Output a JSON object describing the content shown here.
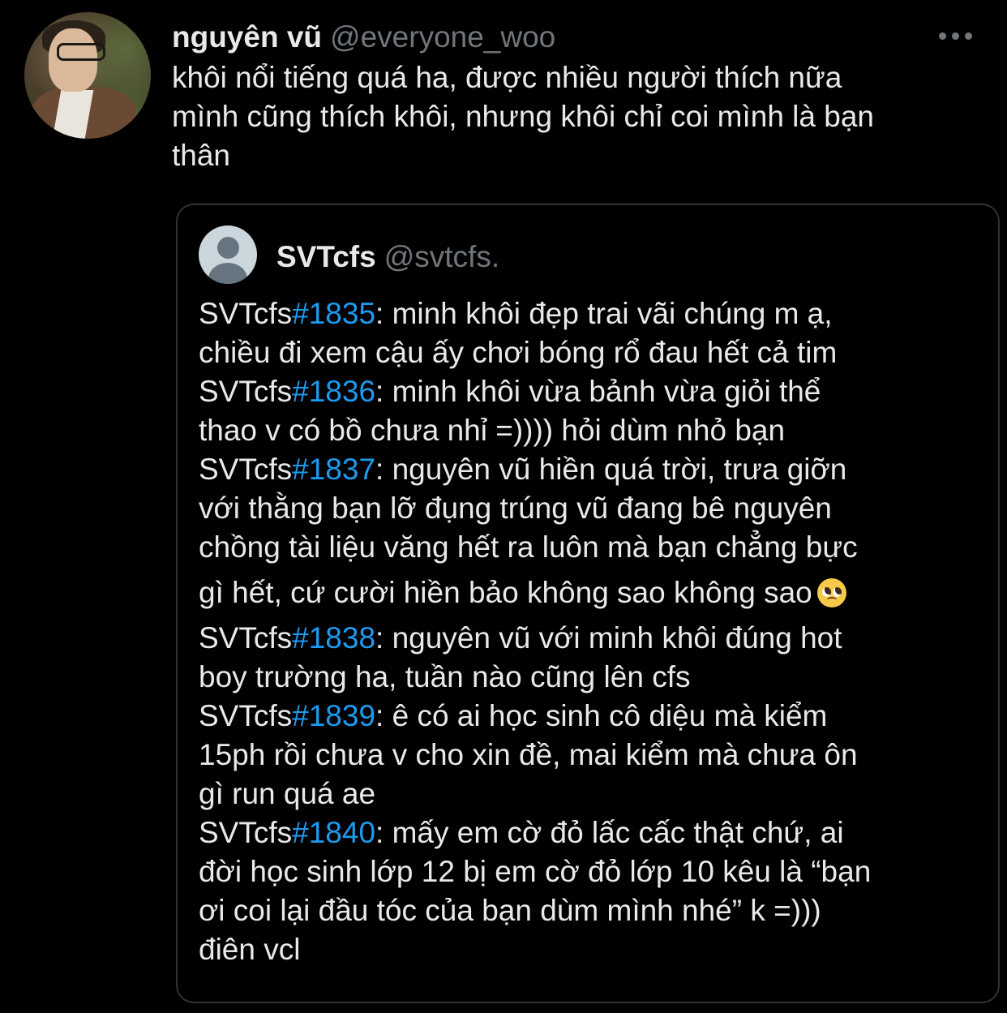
{
  "tweet": {
    "display_name": "nguyên vũ",
    "handle": "@everyone_woo",
    "more_icon": "more-horizontal-icon",
    "text_lines": [
      "khôi nổi tiếng quá ha, được nhiều người thích nữa",
      "mình cũng thích khôi, nhưng khôi chỉ coi mình là bạn",
      "thân"
    ]
  },
  "quote": {
    "display_name": "SVTcfs",
    "handle": "@svtcfs.",
    "avatar_icon": "default-profile-icon",
    "lines": [
      {
        "pre": "SVTcfs",
        "tag": "#1835",
        "text": ": minh khôi đẹp trai vãi chúng m ạ,"
      },
      {
        "pre": "",
        "tag": "",
        "text": "chiều đi xem cậu ấy chơi bóng rổ đau hết cả tim"
      },
      {
        "pre": "SVTcfs",
        "tag": "#1836",
        "text": ": minh khôi vừa bảnh vừa giỏi thể"
      },
      {
        "pre": "",
        "tag": "",
        "text": "thao v có bồ chưa nhỉ =)))) hỏi dùm nhỏ bạn"
      },
      {
        "pre": "SVTcfs",
        "tag": "#1837",
        "text": ": nguyên vũ hiền quá trời, trưa giỡn"
      },
      {
        "pre": "",
        "tag": "",
        "text": "với thằng bạn lỡ đụng trúng vũ đang bê nguyên"
      },
      {
        "pre": "",
        "tag": "",
        "text": "chồng tài liệu văng hết ra luôn mà bạn chẳng bực"
      },
      {
        "pre": "",
        "tag": "",
        "text": "gì hết, cứ cười hiền bảo không sao không sao",
        "emoji": "pleading-face-emoji"
      },
      {
        "pre": "SVTcfs",
        "tag": "#1838",
        "text": ": nguyên vũ với minh khôi đúng hot"
      },
      {
        "pre": "",
        "tag": "",
        "text": "boy trường ha, tuần nào cũng lên cfs"
      },
      {
        "pre": "SVTcfs",
        "tag": "#1839",
        "text": ": ê có ai học sinh cô diệu mà kiểm"
      },
      {
        "pre": "",
        "tag": "",
        "text": "15ph rồi chưa v cho xin đề, mai kiểm mà chưa ôn"
      },
      {
        "pre": "",
        "tag": "",
        "text": "gì run quá ae"
      },
      {
        "pre": "SVTcfs",
        "tag": "#1840",
        "text": ": mấy em cờ đỏ lấc cấc thật chứ, ai"
      },
      {
        "pre": "",
        "tag": "",
        "text": "đời học sinh lớp 12 bị em cờ đỏ lớp 10 kêu là “bạn"
      },
      {
        "pre": "",
        "tag": "",
        "text": "ơi coi lại đầu tóc của bạn dùm mình nhé” k =)))"
      },
      {
        "pre": "",
        "tag": "",
        "text": "điên vcl"
      }
    ]
  },
  "colors": {
    "background": "#000000",
    "text": "#e7e9ea",
    "secondary": "#71767b",
    "link": "#1d9bf0",
    "border": "#2f3336"
  }
}
